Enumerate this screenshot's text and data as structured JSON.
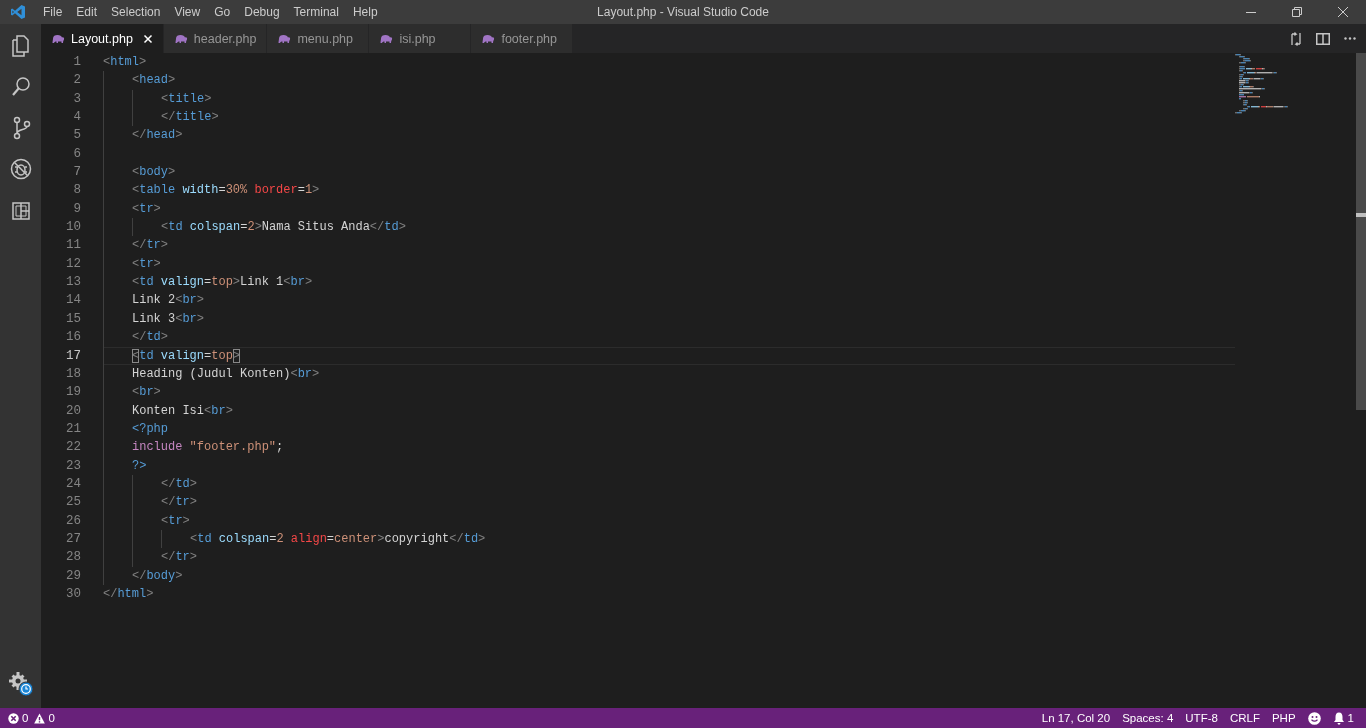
{
  "window": {
    "title": "Layout.php - Visual Studio Code"
  },
  "menu": [
    "File",
    "Edit",
    "Selection",
    "View",
    "Go",
    "Debug",
    "Terminal",
    "Help"
  ],
  "tabs": [
    {
      "label": "Layout.php",
      "selected": true
    },
    {
      "label": "header.php",
      "selected": false
    },
    {
      "label": "menu.php",
      "selected": false
    },
    {
      "label": "isi.php",
      "selected": false
    },
    {
      "label": "footer.php",
      "selected": false
    }
  ],
  "editor": {
    "lines": [
      {
        "number": "1",
        "current": false,
        "tokens": [
          {
            "kind": "punct",
            "text": "<"
          },
          {
            "kind": "tag",
            "text": "html"
          },
          {
            "kind": "punct",
            "text": ">"
          }
        ]
      },
      {
        "number": "2",
        "current": false,
        "tokens": [
          {
            "kind": "punct",
            "text": "    <"
          },
          {
            "kind": "tag",
            "text": "head"
          },
          {
            "kind": "punct",
            "text": ">"
          }
        ]
      },
      {
        "number": "3",
        "current": false,
        "tokens": [
          {
            "kind": "punct",
            "text": "        <"
          },
          {
            "kind": "tag",
            "text": "title"
          },
          {
            "kind": "punct",
            "text": ">"
          }
        ]
      },
      {
        "number": "4",
        "current": false,
        "tokens": [
          {
            "kind": "punct",
            "text": "        </"
          },
          {
            "kind": "tag",
            "text": "title"
          },
          {
            "kind": "punct",
            "text": ">"
          }
        ]
      },
      {
        "number": "5",
        "current": false,
        "tokens": [
          {
            "kind": "punct",
            "text": "    </"
          },
          {
            "kind": "tag",
            "text": "head"
          },
          {
            "kind": "punct",
            "text": ">"
          }
        ]
      },
      {
        "number": "6",
        "current": false
      },
      {
        "number": "7",
        "current": false,
        "tokens": [
          {
            "kind": "punct",
            "text": "    <"
          },
          {
            "kind": "tag",
            "text": "body"
          },
          {
            "kind": "punct",
            "text": ">"
          }
        ]
      },
      {
        "number": "8",
        "current": false,
        "tokens": [
          {
            "kind": "punct",
            "text": "    <"
          },
          {
            "kind": "tag",
            "text": "table"
          },
          {
            "kind": "attr",
            "text": " width"
          },
          {
            "kind": "op",
            "text": "="
          },
          {
            "kind": "value",
            "text": "30%"
          },
          {
            "kind": "error",
            "text": " border"
          },
          {
            "kind": "op",
            "text": "="
          },
          {
            "kind": "value",
            "text": "1"
          },
          {
            "kind": "punct",
            "text": ">"
          }
        ]
      },
      {
        "number": "9",
        "current": false,
        "tokens": [
          {
            "kind": "punct",
            "text": "    <"
          },
          {
            "kind": "tag",
            "text": "tr"
          },
          {
            "kind": "punct",
            "text": ">"
          }
        ]
      },
      {
        "number": "10",
        "current": false,
        "tokens": [
          {
            "kind": "punct",
            "text": "        <"
          },
          {
            "kind": "tag",
            "text": "td"
          },
          {
            "kind": "attr",
            "text": " colspan"
          },
          {
            "kind": "op",
            "text": "="
          },
          {
            "kind": "value",
            "text": "2"
          },
          {
            "kind": "punct",
            "text": ">"
          },
          {
            "kind": "text",
            "text": "Nama Situs Anda"
          },
          {
            "kind": "punct",
            "text": "</"
          },
          {
            "kind": "tag",
            "text": "td"
          },
          {
            "kind": "punct",
            "text": ">"
          }
        ]
      },
      {
        "number": "11",
        "current": false,
        "tokens": [
          {
            "kind": "punct",
            "text": "    </"
          },
          {
            "kind": "tag",
            "text": "tr"
          },
          {
            "kind": "punct",
            "text": ">"
          }
        ]
      },
      {
        "number": "12",
        "current": false,
        "tokens": [
          {
            "kind": "punct",
            "text": "    <"
          },
          {
            "kind": "tag",
            "text": "tr"
          },
          {
            "kind": "punct",
            "text": ">"
          }
        ]
      },
      {
        "number": "13",
        "current": false,
        "tokens": [
          {
            "kind": "punct",
            "text": "    <"
          },
          {
            "kind": "tag",
            "text": "td"
          },
          {
            "kind": "attr",
            "text": " valign"
          },
          {
            "kind": "op",
            "text": "="
          },
          {
            "kind": "value",
            "text": "top"
          },
          {
            "kind": "punct",
            "text": ">"
          },
          {
            "kind": "text",
            "text": "Link 1"
          },
          {
            "kind": "punct",
            "text": "<"
          },
          {
            "kind": "tag",
            "text": "br"
          },
          {
            "kind": "punct",
            "text": ">"
          }
        ]
      },
      {
        "number": "14",
        "current": false,
        "tokens": [
          {
            "kind": "text",
            "text": "    Link 2"
          },
          {
            "kind": "punct",
            "text": "<"
          },
          {
            "kind": "tag",
            "text": "br"
          },
          {
            "kind": "punct",
            "text": ">"
          }
        ]
      },
      {
        "number": "15",
        "current": false,
        "tokens": [
          {
            "kind": "text",
            "text": "    Link 3"
          },
          {
            "kind": "punct",
            "text": "<"
          },
          {
            "kind": "tag",
            "text": "br"
          },
          {
            "kind": "punct",
            "text": ">"
          }
        ]
      },
      {
        "number": "16",
        "current": false,
        "tokens": [
          {
            "kind": "punct",
            "text": "    </"
          },
          {
            "kind": "tag",
            "text": "td"
          },
          {
            "kind": "punct",
            "text": ">"
          }
        ]
      },
      {
        "number": "17",
        "current": true,
        "tokens": [
          {
            "kind": "bracket-match",
            "text": "    <"
          },
          {
            "kind": "tag",
            "text": "td"
          },
          {
            "kind": "attr",
            "text": " valign"
          },
          {
            "kind": "op",
            "text": "="
          },
          {
            "kind": "value",
            "text": "top"
          },
          {
            "kind": "bracket-match",
            "text": ">"
          }
        ]
      },
      {
        "number": "18",
        "current": false,
        "tokens": [
          {
            "kind": "text",
            "text": "    Heading (Judul Konten)"
          },
          {
            "kind": "punct",
            "text": "<"
          },
          {
            "kind": "tag",
            "text": "br"
          },
          {
            "kind": "punct",
            "text": ">"
          }
        ]
      },
      {
        "number": "19",
        "current": false,
        "tokens": [
          {
            "kind": "punct",
            "text": "    <"
          },
          {
            "kind": "tag",
            "text": "br"
          },
          {
            "kind": "punct",
            "text": ">"
          }
        ]
      },
      {
        "number": "20",
        "current": false,
        "tokens": [
          {
            "kind": "text",
            "text": "    Konten Isi"
          },
          {
            "kind": "punct",
            "text": "<"
          },
          {
            "kind": "tag",
            "text": "br"
          },
          {
            "kind": "punct",
            "text": ">"
          }
        ]
      },
      {
        "number": "21",
        "current": false,
        "tokens": [
          {
            "kind": "tag",
            "text": "    <?php"
          }
        ]
      },
      {
        "number": "22",
        "current": false,
        "tokens": [
          {
            "kind": "keyword",
            "text": "    include"
          },
          {
            "kind": "string",
            "text": " \"footer.php\""
          },
          {
            "kind": "op",
            "text": ";"
          }
        ]
      },
      {
        "number": "23",
        "current": false,
        "tokens": [
          {
            "kind": "tag",
            "text": "    ?>"
          }
        ]
      },
      {
        "number": "24",
        "current": false,
        "tokens": [
          {
            "kind": "punct",
            "text": "        </"
          },
          {
            "kind": "tag",
            "text": "td"
          },
          {
            "kind": "punct",
            "text": ">"
          }
        ]
      },
      {
        "number": "25",
        "current": false,
        "tokens": [
          {
            "kind": "punct",
            "text": "        </"
          },
          {
            "kind": "tag",
            "text": "tr"
          },
          {
            "kind": "punct",
            "text": ">"
          }
        ]
      },
      {
        "number": "26",
        "current": false,
        "tokens": [
          {
            "kind": "punct",
            "text": "        <"
          },
          {
            "kind": "tag",
            "text": "tr"
          },
          {
            "kind": "punct",
            "text": ">"
          }
        ]
      },
      {
        "number": "27",
        "current": false,
        "tokens": [
          {
            "kind": "punct",
            "text": "            <"
          },
          {
            "kind": "tag",
            "text": "td"
          },
          {
            "kind": "attr",
            "text": " colspan"
          },
          {
            "kind": "op",
            "text": "="
          },
          {
            "kind": "value",
            "text": "2"
          },
          {
            "kind": "error",
            "text": " align"
          },
          {
            "kind": "op",
            "text": "="
          },
          {
            "kind": "value",
            "text": "center"
          },
          {
            "kind": "punct",
            "text": ">"
          },
          {
            "kind": "text",
            "text": "copyright"
          },
          {
            "kind": "punct",
            "text": "</"
          },
          {
            "kind": "tag",
            "text": "td"
          },
          {
            "kind": "punct",
            "text": ">"
          }
        ]
      },
      {
        "number": "28",
        "current": false,
        "tokens": [
          {
            "kind": "punct",
            "text": "        </"
          },
          {
            "kind": "tag",
            "text": "tr"
          },
          {
            "kind": "punct",
            "text": ">"
          }
        ]
      },
      {
        "number": "29",
        "current": false,
        "tokens": [
          {
            "kind": "punct",
            "text": "    </"
          },
          {
            "kind": "tag",
            "text": "body"
          },
          {
            "kind": "punct",
            "text": ">"
          }
        ]
      },
      {
        "number": "30",
        "current": false,
        "tokens": [
          {
            "kind": "punct",
            "text": "</"
          },
          {
            "kind": "tag",
            "text": "html"
          },
          {
            "kind": "punct",
            "text": ">"
          }
        ]
      }
    ]
  },
  "status_bar": {
    "errors": "0",
    "warnings": "0",
    "items": [
      "Ln 17, Col 20",
      "Spaces: 4",
      "UTF-8",
      "CRLF",
      "PHP"
    ],
    "notifications": "1"
  }
}
